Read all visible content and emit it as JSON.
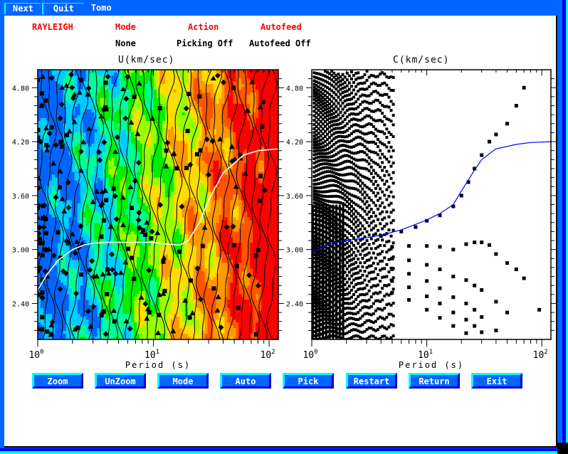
{
  "menubar": {
    "next_label": "Next",
    "quit_label": "Quit",
    "title": "Tomo"
  },
  "header": {
    "wave_type": "RAYLEIGH",
    "mode_label": "Mode",
    "action_label": "Action",
    "autofeed_label": "Autofeed",
    "mode_value": "None",
    "action_value": "Picking Off",
    "autofeed_value": "Autofeed Off"
  },
  "colors": {
    "frame": "#0066ff",
    "frame_highlight": "#00ffff",
    "header_red": "#ff0000",
    "group_curve": "#ffffff",
    "phase_curve": "#0000ff"
  },
  "buttons": [
    {
      "id": "zoom",
      "label": "Zoom"
    },
    {
      "id": "unzoom",
      "label": "UnZoom"
    },
    {
      "id": "mode",
      "label": "Mode"
    },
    {
      "id": "auto",
      "label": "Auto"
    },
    {
      "id": "pick",
      "label": "Pick"
    },
    {
      "id": "restart",
      "label": "Restart"
    },
    {
      "id": "return",
      "label": "Return"
    },
    {
      "id": "exit",
      "label": "Exit"
    }
  ],
  "chart_data": [
    {
      "type": "heatmap",
      "title": "U(km/sec)",
      "xlabel": "Period (s)",
      "ylabel": "",
      "xscale": "log",
      "xlim": [
        1,
        120
      ],
      "ylim": [
        2.0,
        5.0
      ],
      "x_tick_labels": [
        "10^0",
        "10^1",
        "10^2"
      ],
      "y_tick_labels": [
        "2.40",
        "3.00",
        "3.60",
        "4.20",
        "4.80"
      ],
      "y_ticks": [
        2.4,
        3.0,
        3.6,
        4.2,
        4.8
      ],
      "colormap": [
        "#0066ff",
        "#00ccff",
        "#00ff99",
        "#00ee00",
        "#99ff00",
        "#ffdd00",
        "#ff9900",
        "#ff5500",
        "#ff0000"
      ],
      "description": "FTAN group-velocity amplitude contours, low amplitude (blue) at short periods rising to high (red) at long periods, with dispersion markers (squares, diamonds, triangles) overlaid",
      "curve": {
        "name": "group velocity model",
        "color": "#ffffff",
        "x": [
          1.0,
          1.2,
          1.5,
          2.0,
          2.5,
          3.0,
          4.0,
          6.0,
          8.0,
          10.0,
          13.0,
          17.0,
          20.0,
          25.0,
          30.0,
          40.0,
          60.0,
          80.0,
          120.0
        ],
        "y": [
          2.55,
          2.72,
          2.88,
          3.0,
          3.05,
          3.07,
          3.08,
          3.08,
          3.08,
          3.08,
          3.06,
          3.05,
          3.1,
          3.3,
          3.55,
          3.85,
          4.05,
          4.1,
          4.12
        ]
      }
    },
    {
      "type": "scatter",
      "title": "C(km/sec)",
      "xlabel": "Period (s)",
      "ylabel": "",
      "xscale": "log",
      "xlim": [
        1,
        120
      ],
      "ylim": [
        2.0,
        5.0
      ],
      "x_tick_labels": [
        "10^0",
        "10^1",
        "10^2"
      ],
      "y_tick_labels": [
        "2.40",
        "3.00",
        "3.60",
        "4.20",
        "4.80"
      ],
      "y_ticks": [
        2.4,
        3.0,
        3.6,
        4.2,
        4.8
      ],
      "description": "Phase-velocity branch candidates (black squares) densely packed at short periods, diverging to fans at longer periods",
      "branches": [
        {
          "name": "fundamental",
          "x": [
            4.0,
            6.0,
            8.0,
            10.0,
            13.0,
            17.0,
            20.0,
            23.0,
            26.0,
            30.0,
            35.0,
            40.0,
            50.0,
            60.0,
            70.0
          ],
          "y": [
            3.15,
            3.2,
            3.25,
            3.32,
            3.38,
            3.48,
            3.6,
            3.75,
            3.9,
            4.05,
            4.2,
            4.28,
            4.4,
            4.6,
            4.8
          ]
        },
        {
          "name": "lower-1",
          "x": [
            5.0,
            7.0,
            10.0,
            13.0,
            17.0,
            22.0,
            26.0,
            30.0,
            35.0,
            40.0,
            50.0,
            60.0,
            70.0
          ],
          "y": [
            3.03,
            3.04,
            3.04,
            3.03,
            3.0,
            3.06,
            3.08,
            3.08,
            3.05,
            2.95,
            2.85,
            2.78,
            2.68
          ]
        },
        {
          "name": "lower-2",
          "x": [
            5.0,
            7.0,
            10.0,
            13.0,
            17.0,
            22.0,
            26.0,
            30.0,
            40.0,
            50.0
          ],
          "y": [
            2.9,
            2.88,
            2.83,
            2.78,
            2.7,
            2.66,
            2.6,
            2.55,
            2.42,
            2.3
          ]
        },
        {
          "name": "lower-3",
          "x": [
            5.0,
            7.0,
            10.0,
            13.0,
            17.0,
            22.0,
            26.0,
            30.0,
            40.0
          ],
          "y": [
            2.78,
            2.73,
            2.65,
            2.57,
            2.47,
            2.4,
            2.33,
            2.25,
            2.1
          ]
        },
        {
          "name": "lower-4",
          "x": [
            5.0,
            7.0,
            10.0,
            13.0,
            17.0,
            22.0,
            26.0,
            30.0
          ],
          "y": [
            2.65,
            2.58,
            2.48,
            2.4,
            2.3,
            2.22,
            2.15,
            2.08
          ]
        },
        {
          "name": "lower-5",
          "x": [
            5.0,
            7.0,
            10.0,
            13.0,
            17.0,
            22.0
          ],
          "y": [
            2.52,
            2.44,
            2.33,
            2.24,
            2.15,
            2.07
          ]
        },
        {
          "name": "isolated",
          "x": [
            95.0
          ],
          "y": [
            2.33
          ]
        }
      ],
      "curve": {
        "name": "phase velocity model",
        "color": "#0000ff",
        "x": [
          1.0,
          1.5,
          2.0,
          3.0,
          4.0,
          6.0,
          8.0,
          10.0,
          13.0,
          17.0,
          20.0,
          25.0,
          30.0,
          40.0,
          60.0,
          80.0,
          120.0
        ],
        "y": [
          2.97,
          3.07,
          3.1,
          3.13,
          3.16,
          3.22,
          3.28,
          3.33,
          3.4,
          3.5,
          3.65,
          3.85,
          4.0,
          4.12,
          4.17,
          4.19,
          4.2
        ]
      }
    }
  ]
}
